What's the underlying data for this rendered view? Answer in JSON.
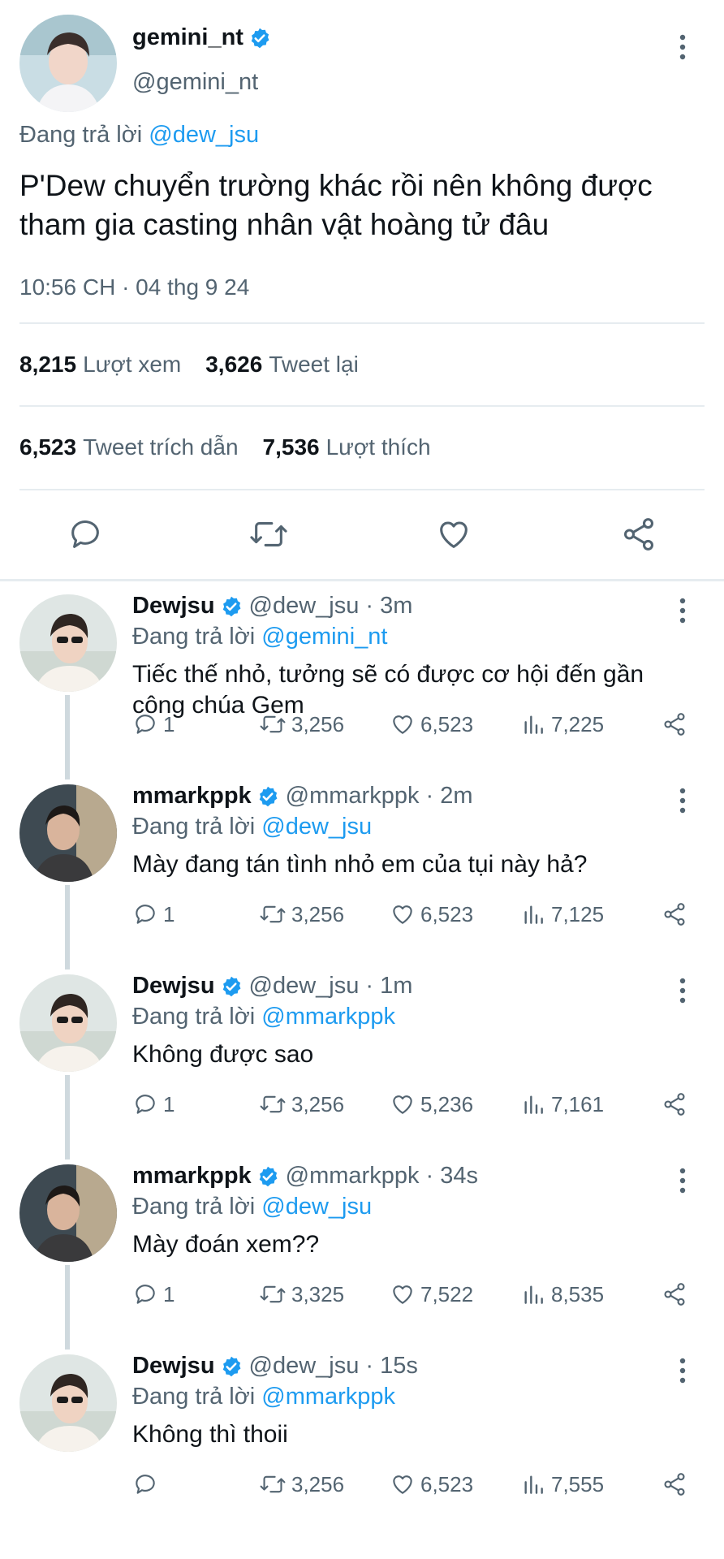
{
  "main_tweet": {
    "name": "gemini_nt",
    "handle": "@gemini_nt",
    "replying_prefix": "Đang trả lời",
    "replying_to": "@dew_jsu",
    "text": "P'Dew chuyển trường khác rồi nên không được tham gia casting nhân vật hoàng tử đâu",
    "timestamp": "10:56 CH · 04 thg 9 24",
    "stats": {
      "views_count": "8,215",
      "views_label": "Lượt xem",
      "retweets_count": "3,626",
      "retweets_label": "Tweet lại",
      "quotes_count": "6,523",
      "quotes_label": "Tweet trích dẫn",
      "likes_count": "7,536",
      "likes_label": "Lượt thích"
    }
  },
  "replies": [
    {
      "name": "Dewjsu",
      "handle": "@dew_jsu · 3m",
      "replying_prefix": "Đang trả lời",
      "replying_to": "@gemini_nt",
      "text": "Tiếc thế nhỏ, tưởng sẽ có được cơ hội đến gần công chúa Gem",
      "replies": "1",
      "retweets": "3,256",
      "likes": "6,523",
      "views": "7,225"
    },
    {
      "name": "mmarkppk",
      "handle": "@mmarkppk · 2m",
      "replying_prefix": "Đang trả lời",
      "replying_to": "@dew_jsu",
      "text": "Mày đang tán tình nhỏ em của tụi này hả?",
      "replies": "1",
      "retweets": "3,256",
      "likes": "6,523",
      "views": "7,125"
    },
    {
      "name": "Dewjsu",
      "handle": "@dew_jsu · 1m",
      "replying_prefix": "Đang trả lời",
      "replying_to": "@mmarkppk",
      "text": "Không được sao",
      "replies": "1",
      "retweets": "3,256",
      "likes": "5,236",
      "views": "7,161"
    },
    {
      "name": "mmarkppk",
      "handle": "@mmarkppk · 34s",
      "replying_prefix": "Đang trả lời",
      "replying_to": "@dew_jsu",
      "text": "Mày đoán xem??",
      "replies": "1",
      "retweets": "3,325",
      "likes": "7,522",
      "views": "8,535"
    },
    {
      "name": "Dewjsu",
      "handle": "@dew_jsu · 15s",
      "replying_prefix": "Đang trả lời",
      "replying_to": "@mmarkppk",
      "text": "Không thì thoii",
      "replies": "",
      "retweets": "3,256",
      "likes": "6,523",
      "views": "7,555"
    }
  ],
  "colors": {
    "accent": "#1d9bf0",
    "text": "#0f1419",
    "muted": "#536471",
    "divider": "#e6ecf0"
  }
}
